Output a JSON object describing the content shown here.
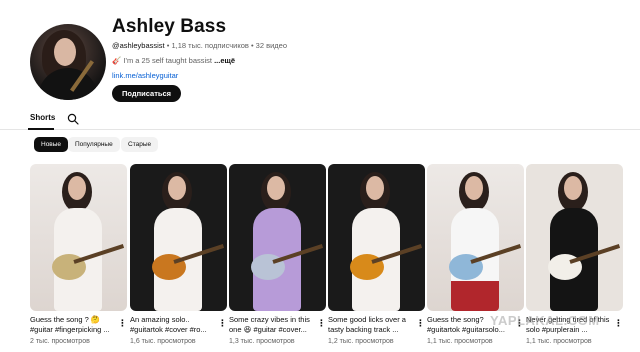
{
  "channel": {
    "name": "Ashley Bass",
    "handle": "@ashleybassist",
    "subscribers": "1,18 тыс. подписчиков",
    "videos": "32 видео",
    "description_emoji": "🎸",
    "description": "I'm a 25 self taught bassist",
    "more_label": "...ещё",
    "link": "link.me/ashleyguitar",
    "subscribe_label": "Подписаться"
  },
  "tabs": [
    {
      "label": "Shorts",
      "active": true
    }
  ],
  "search_icon": "search-icon",
  "filters": [
    {
      "label": "Новые",
      "active": true
    },
    {
      "label": "Популярные",
      "active": false
    },
    {
      "label": "Старые",
      "active": false
    }
  ],
  "videos": [
    {
      "title": "Guess the song ? 🤔 #guitar #fingerpicking ...",
      "views": "2 тыс. просмотров",
      "guitar_color": "#c8b27a",
      "theme": "light"
    },
    {
      "title": "An amazing solo.. #guitartok #cover #ro...",
      "views": "1,6 тыс. просмотров",
      "guitar_color": "#c9771f",
      "theme": "dark"
    },
    {
      "title": "Some crazy vibes in this one 😆 #guitar #cover...",
      "views": "1,3 тыс. просмотров",
      "guitar_color": "#b9c3d6",
      "theme": "dark"
    },
    {
      "title": "Some good licks over a tasty backing track ...",
      "views": "1,2 тыс. просмотров",
      "guitar_color": "#d88a1a",
      "theme": "dark"
    },
    {
      "title": "Guess the song? #guitartok #guitarsolo...",
      "views": "1,1 тыс. просмотров",
      "guitar_color": "#8fb7d8",
      "theme": "light"
    },
    {
      "title": "Never getting tired of this solo #purplerain ...",
      "views": "1,1 тыс. просмотров",
      "guitar_color": "#f2efe9",
      "theme": "dark"
    }
  ],
  "watermark": "YAPLAKAL.COM"
}
